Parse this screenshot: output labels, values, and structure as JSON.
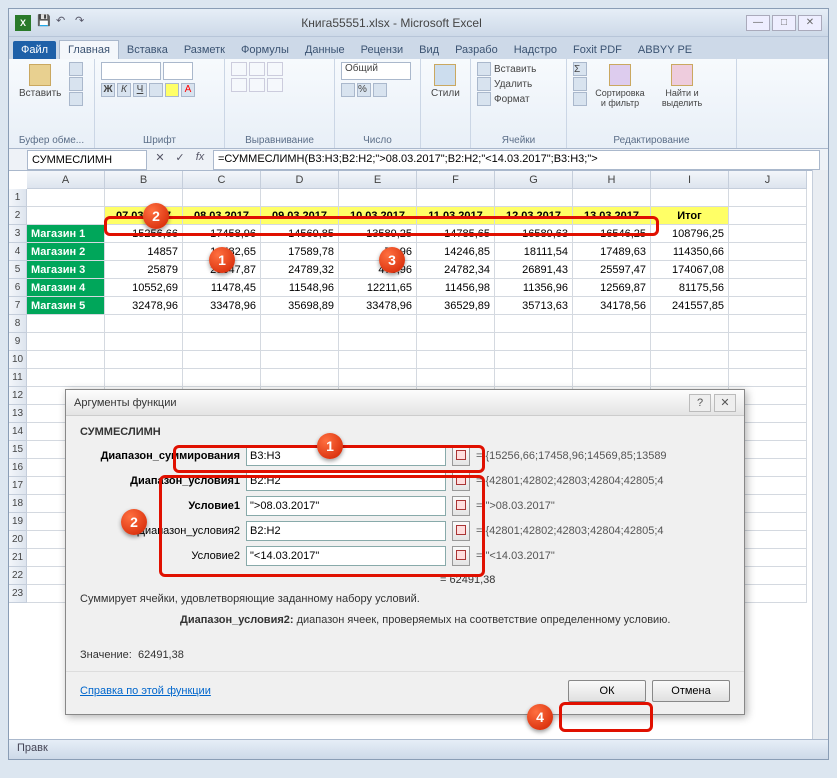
{
  "title": "Книга55551.xlsx - Microsoft Excel",
  "tabs": {
    "file": "Файл",
    "home": "Главная",
    "insert": "Вставка",
    "layout": "Разметк",
    "formulas": "Формулы",
    "data": "Данные",
    "review": "Рецензи",
    "view": "Вид",
    "dev": "Разрабо",
    "addins": "Надстро",
    "foxit": "Foxit PDF",
    "abbyy": "ABBYY PE"
  },
  "ribbon": {
    "clipboard": {
      "paste": "Вставить",
      "label": "Буфер обме..."
    },
    "font": {
      "label": "Шрифт"
    },
    "align": {
      "label": "Выравнивание"
    },
    "number": {
      "format": "Общий",
      "label": "Число"
    },
    "styles": {
      "btn": "Стили",
      "label": ""
    },
    "cells": {
      "insert": "Вставить",
      "delete": "Удалить",
      "format": "Формат",
      "label": "Ячейки"
    },
    "editing": {
      "sort": "Сортировка и фильтр",
      "find": "Найти и выделить",
      "label": "Редактирование"
    }
  },
  "namebox": "СУММЕСЛИМН",
  "formula": "=СУММЕСЛИМН(B3:H3;B2:H2;\">08.03.2017\";B2:H2;\"<14.03.2017\";B3:H3;\">",
  "columns": [
    "A",
    "B",
    "C",
    "D",
    "E",
    "F",
    "G",
    "H",
    "I",
    "J"
  ],
  "rows": [
    "1",
    "2",
    "3",
    "4",
    "5",
    "6",
    "7",
    "8",
    "9",
    "10",
    "11",
    "12",
    "13",
    "14",
    "15",
    "16",
    "17",
    "18",
    "19",
    "20",
    "21",
    "22",
    "23"
  ],
  "dates": [
    "07.03.2017",
    "08.03.2017",
    "09.03.2017",
    "10.03.2017",
    "11.03.2017",
    "12.03.2017",
    "13.03.2017"
  ],
  "itog_label": "Итог",
  "shops": [
    {
      "name": "Магазин 1",
      "vals": [
        "15256,66",
        "17458,96",
        "14569,85",
        "13589,25",
        "14785,65",
        "16589,63",
        "16546,25"
      ],
      "total": "108796,25"
    },
    {
      "name": "Магазин 2",
      "vals": [
        "14857",
        "16582,65",
        "17589,78",
        "78,96",
        "14246,85",
        "18111,54",
        "17489,63"
      ],
      "total": "114350,66"
    },
    {
      "name": "Магазин 3",
      "vals": [
        "25879",
        "23647,87",
        "24789,32",
        "478,96",
        "24782,34",
        "26891,43",
        "25597,47"
      ],
      "total": "174067,08"
    },
    {
      "name": "Магазин 4",
      "vals": [
        "10552,69",
        "11478,45",
        "11548,96",
        "12211,65",
        "11456,98",
        "11356,96",
        "12569,87"
      ],
      "total": "81175,56"
    },
    {
      "name": "Магазин 5",
      "vals": [
        "32478,96",
        "33478,96",
        "35698,89",
        "33478,96",
        "36529,89",
        "35713,63",
        "34178,56"
      ],
      "total": "241557,85"
    }
  ],
  "dialog": {
    "title": "Аргументы функции",
    "fn": "СУММЕСЛИМН",
    "args": [
      {
        "label": "Диапазон_суммирования",
        "val": "B3:H3",
        "res": "= {15256,66;17458,96;14569,85;13589",
        "bold": true
      },
      {
        "label": "Диапазон_условия1",
        "val": "B2:H2",
        "res": "= {42801;42802;42803;42804;42805;4",
        "bold": true
      },
      {
        "label": "Условие1",
        "val": "\">08.03.2017\"",
        "res": "= \">08.03.2017\"",
        "bold": true
      },
      {
        "label": "Диапазон_условия2",
        "val": "B2:H2",
        "res": "= {42801;42802;42803;42804;42805;4",
        "bold": false
      },
      {
        "label": "Условие2",
        "val": "\"<14.03.2017\"",
        "res": "= \"<14.03.2017\"",
        "bold": false
      }
    ],
    "result": "= 62491,38",
    "desc_pre": "Суммирует ячейки, удовлетворяющие заданному набору условий.",
    "desc_arg": "Диапазон_условия2:",
    "desc_txt": "диапазон ячеек, проверяемых на соответствие определенному условию.",
    "value_label": "Значение:",
    "value": "62491,38",
    "help": "Справка по этой функции",
    "ok": "ОК",
    "cancel": "Отмена"
  },
  "status": "Правк"
}
